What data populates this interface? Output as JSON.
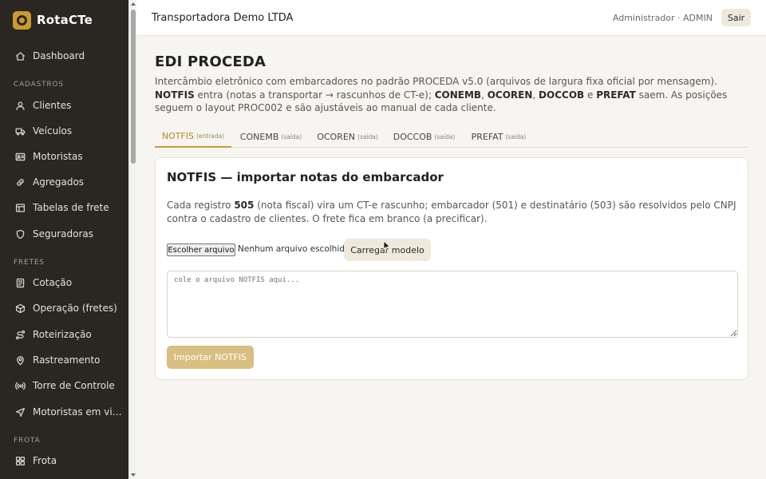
{
  "brand": {
    "name": "RotaCTe"
  },
  "sidebar": {
    "items": [
      {
        "label": "Dashboard",
        "icon": "home-icon"
      },
      {
        "label": "Clientes",
        "icon": "user-icon"
      },
      {
        "label": "Veículos",
        "icon": "truck-icon"
      },
      {
        "label": "Motoristas",
        "icon": "id-card-icon"
      },
      {
        "label": "Agregados",
        "icon": "link-icon"
      },
      {
        "label": "Tabelas de frete",
        "icon": "table-icon"
      },
      {
        "label": "Seguradoras",
        "icon": "shield-icon"
      },
      {
        "label": "Cotação",
        "icon": "document-icon"
      },
      {
        "label": "Operação (fretes)",
        "icon": "box-icon"
      },
      {
        "label": "Roteirização",
        "icon": "route-icon"
      },
      {
        "label": "Rastreamento",
        "icon": "map-pin-icon"
      },
      {
        "label": "Torre de Controle",
        "icon": "broadcast-icon"
      },
      {
        "label": "Motoristas em viag...",
        "icon": "navigation-icon"
      },
      {
        "label": "Frota",
        "icon": "grid-icon"
      }
    ],
    "sections": [
      "CADASTROS",
      "FRETES",
      "FROTA"
    ]
  },
  "topbar": {
    "company": "Transportadora Demo LTDA",
    "user": "Administrador · ADMIN",
    "logout_label": "Sair"
  },
  "page": {
    "title": "EDI PROCEDA",
    "desc_1": "Intercâmbio eletrônico com embarcadores no padrão PROCEDA v5.0 (arquivos de largura fixa oficial por mensagem). ",
    "desc_notfis": "NOTFIS",
    "desc_2": " entra (notas a transportar → rascunhos de CT-e); ",
    "desc_conemb": "CONEMB",
    "desc_sep1": ", ",
    "desc_ocoren": "OCOREN",
    "desc_sep2": ", ",
    "desc_doccob": "DOCCOB",
    "desc_sep3": " e ",
    "desc_prefat": "PREFAT",
    "desc_3": " saem. As posições seguem o layout PROC002 e são ajustáveis ao manual de cada cliente."
  },
  "tabs": [
    {
      "label": "NOTFIS",
      "sub": "(entrada)"
    },
    {
      "label": "CONEMB",
      "sub": "(saída)"
    },
    {
      "label": "OCOREN",
      "sub": "(saída)"
    },
    {
      "label": "DOCCOB",
      "sub": "(saída)"
    },
    {
      "label": "PREFAT",
      "sub": "(saída)"
    }
  ],
  "card": {
    "title": "NOTFIS — importar notas do embarcador",
    "desc_1": "Cada registro ",
    "desc_505": "505",
    "desc_2": " (nota fiscal) vira um CT-e rascunho; embarcador (501) e destinatário (503) são resolvidos pelo CNPJ contra o cadastro de clientes. O frete fica em branco (a precificar).",
    "file_button": "Escolher arquivo",
    "file_status": "Nenhum arquivo escolhido",
    "template_button": "Carregar modelo",
    "textarea_placeholder": "cole o arquivo NOTFIS aqui...",
    "import_button": "Importar NOTFIS"
  },
  "colors": {
    "accent": "#c99b2e",
    "sidebar_bg": "#2a2622",
    "import_button_bg": "#d9bf82"
  }
}
